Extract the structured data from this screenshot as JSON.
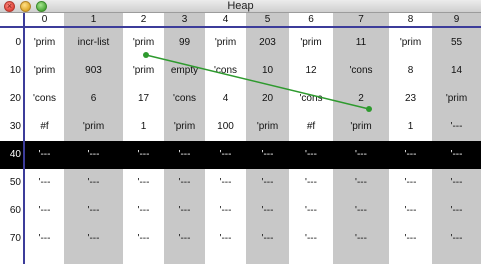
{
  "window": {
    "title": "Heap"
  },
  "columns": [
    "0",
    "1",
    "2",
    "3",
    "4",
    "5",
    "6",
    "7",
    "8",
    "9"
  ],
  "rows": [
    {
      "label": "0",
      "cells": [
        "'prim",
        "incr-list",
        "'prim",
        "99",
        "'prim",
        "203",
        "'prim",
        "11",
        "'prim",
        "55"
      ]
    },
    {
      "label": "10",
      "cells": [
        "'prim",
        "903",
        "'prim",
        "empty",
        "'cons",
        "10",
        "12",
        "'cons",
        "8",
        "14"
      ]
    },
    {
      "label": "20",
      "cells": [
        "'cons",
        "6",
        "17",
        "'cons",
        "4",
        "20",
        "'cons",
        "2",
        "23",
        "'prim"
      ]
    },
    {
      "label": "30",
      "cells": [
        "#f",
        "'prim",
        "1",
        "'prim",
        "100",
        "'prim",
        "#f",
        "'prim",
        "1",
        "'---"
      ]
    },
    {
      "label": "40",
      "selected": true,
      "cells": [
        "'---",
        "'---",
        "'---",
        "'---",
        "'---",
        "'---",
        "'---",
        "'---",
        "'---",
        "'---"
      ]
    },
    {
      "label": "50",
      "cells": [
        "'---",
        "'---",
        "'---",
        "'---",
        "'---",
        "'---",
        "'---",
        "'---",
        "'---",
        "'---"
      ]
    },
    {
      "label": "60",
      "cells": [
        "'---",
        "'---",
        "'---",
        "'---",
        "'---",
        "'---",
        "'---",
        "'---",
        "'---",
        "'---"
      ]
    },
    {
      "label": "70",
      "cells": [
        "'---",
        "'---",
        "'---",
        "'---",
        "'---",
        "'---",
        "'---",
        "'---",
        "'---",
        "'---"
      ]
    }
  ],
  "colors": {
    "grid_line": "#3c3c9a",
    "band_gray": "#c8c8c8",
    "pointer": "#2e9a2e",
    "selected_row": "#000000"
  },
  "pointer": {
    "from": "2",
    "to": "27"
  }
}
